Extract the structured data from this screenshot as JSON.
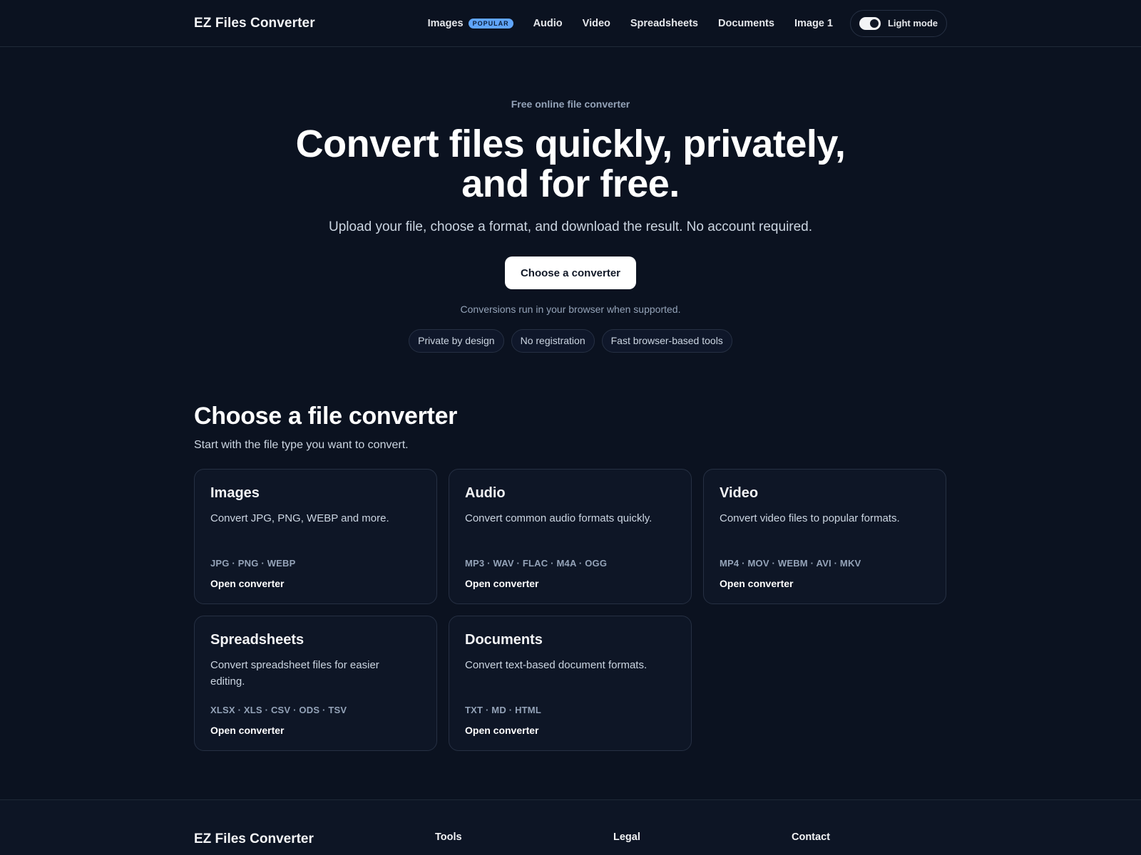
{
  "header": {
    "brand": "EZ Files Converter",
    "nav": [
      {
        "label": "Images",
        "badge": "POPULAR"
      },
      {
        "label": "Audio"
      },
      {
        "label": "Video"
      },
      {
        "label": "Spreadsheets"
      },
      {
        "label": "Documents"
      },
      {
        "label": "Image 1"
      }
    ],
    "mode_toggle_label": "Light mode"
  },
  "hero": {
    "eyebrow": "Free online file converter",
    "headline": "Convert files quickly, privately, and for free.",
    "subtitle": "Upload your file, choose a format, and download the result. No account required.",
    "cta_label": "Choose a converter",
    "note": "Conversions run in your browser when supported.",
    "chips": [
      "Private by design",
      "No registration",
      "Fast browser-based tools"
    ]
  },
  "converters": {
    "title": "Choose a file converter",
    "subtitle": "Start with the file type you want to convert.",
    "cards": [
      {
        "title": "Images",
        "description": "Convert JPG, PNG, WEBP and more.",
        "formats": "JPG · PNG · WEBP",
        "link": "Open converter"
      },
      {
        "title": "Audio",
        "description": "Convert common audio formats quickly.",
        "formats": "MP3 · WAV · FLAC · M4A · OGG",
        "link": "Open converter"
      },
      {
        "title": "Video",
        "description": "Convert video files to popular formats.",
        "formats": "MP4 · MOV · WEBM · AVI · MKV",
        "link": "Open converter"
      },
      {
        "title": "Spreadsheets",
        "description": "Convert spreadsheet files for easier editing.",
        "formats": "XLSX · XLS · CSV · ODS · TSV",
        "link": "Open converter"
      },
      {
        "title": "Documents",
        "description": "Convert text-based document formats.",
        "formats": "TXT · MD · HTML",
        "link": "Open converter"
      }
    ]
  },
  "footer": {
    "brand": "EZ Files Converter",
    "columns": [
      "Tools",
      "Legal",
      "Contact"
    ]
  },
  "colors": {
    "background": "#0b1220",
    "badge": "#60a5fa",
    "card_border": "#263043"
  }
}
